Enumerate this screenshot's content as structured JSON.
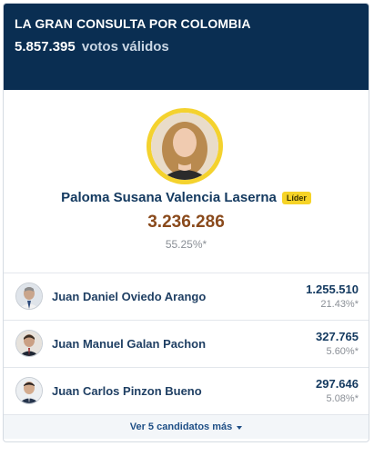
{
  "header": {
    "title": "LA GRAN CONSULTA POR COLOMBIA",
    "total_votes": "5.857.395",
    "votes_label": "votos válidos"
  },
  "leader": {
    "name": "Paloma Susana Valencia Laserna",
    "badge": "Líder",
    "votes": "3.236.286",
    "percent": "55.25%*",
    "avatar_ring_color": "#f4d22e"
  },
  "candidates": [
    {
      "name": "Juan Daniel Oviedo Arango",
      "votes": "1.255.510",
      "percent": "21.43%*"
    },
    {
      "name": "Juan Manuel Galan Pachon",
      "votes": "327.765",
      "percent": "5.60%*"
    },
    {
      "name": "Juan Carlos Pinzon Bueno",
      "votes": "297.646",
      "percent": "5.08%*"
    }
  ],
  "more_button": {
    "label": "Ver 5 candidatos más",
    "icon": "chevron-down-icon"
  },
  "colors": {
    "header_bg": "#0a2e52",
    "leader_votes": "#8a4a1c",
    "badge": "#f6d327"
  }
}
